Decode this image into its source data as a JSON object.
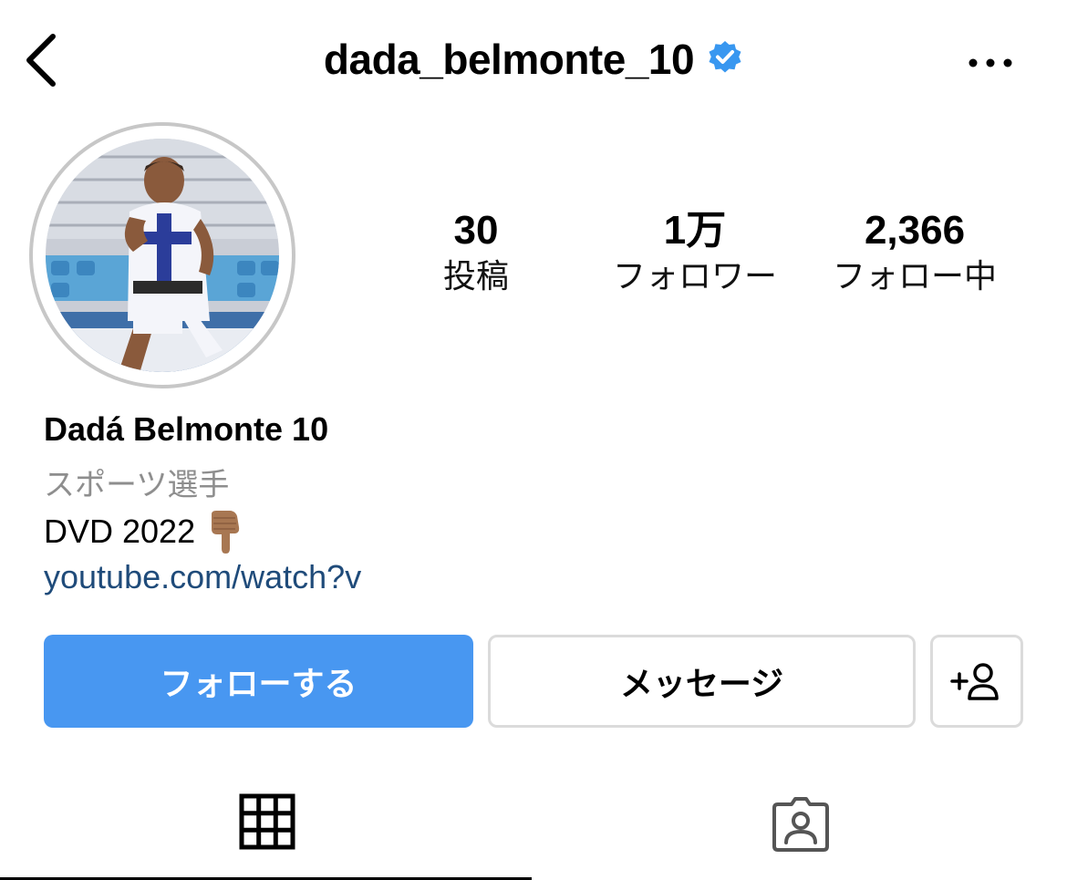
{
  "header": {
    "username": "dada_belmonte_10",
    "verified_icon": "verified-badge-icon",
    "back_icon": "chevron-left-icon",
    "more_icon": "more-horizontal-icon"
  },
  "profile": {
    "display_name": "Dadá Belmonte 10",
    "category": "スポーツ選手",
    "bio": "DVD 2022",
    "bio_emoji": "backhand-index-pointing-down-icon",
    "link": "youtube.com/watch?v"
  },
  "stats": [
    {
      "count": "30",
      "label": "投稿"
    },
    {
      "count": "1万",
      "label": "フォロワー"
    },
    {
      "count": "2,366",
      "label": "フォロー中"
    }
  ],
  "actions": {
    "follow_label": "フォローする",
    "message_label": "メッセージ",
    "add_user_icon": "add-person-icon"
  },
  "tabs": [
    {
      "icon": "grid-icon",
      "selected": true
    },
    {
      "icon": "tagged-person-icon",
      "selected": false
    }
  ],
  "colors": {
    "follow_button": "#4897f1",
    "verified": "#3897f0",
    "link": "#1f4b7a",
    "category_gray": "#8e8e8e",
    "border_gray": "#dbdbdb"
  }
}
